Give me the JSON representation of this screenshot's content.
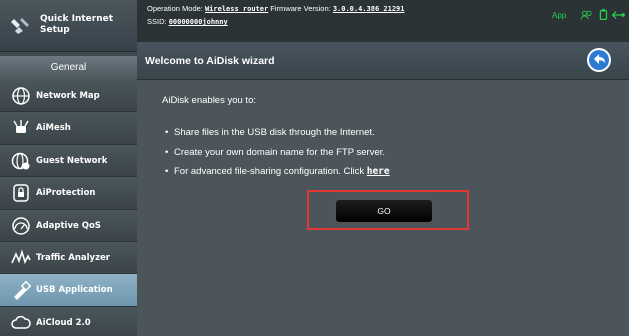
{
  "sidebar": {
    "quick_setup": "Quick Internet Setup",
    "section_header": "General",
    "items": [
      {
        "label": "Network Map"
      },
      {
        "label": "AiMesh"
      },
      {
        "label": "Guest Network"
      },
      {
        "label": "AiProtection"
      },
      {
        "label": "Adaptive QoS"
      },
      {
        "label": "Traffic Analyzer"
      },
      {
        "label": "USB Application",
        "active": true
      },
      {
        "label": "AiCloud 2.0"
      }
    ]
  },
  "header": {
    "op_mode_label": "Operation Mode:",
    "op_mode_value": "Wireless router",
    "fw_label": "Firmware Version:",
    "fw_value": "3.0.0.4.386_21291",
    "ssid_label": "SSID:",
    "ssid_value": "00000000johnny",
    "app_label": "App",
    "status_colors": {
      "app": "#2bd34b"
    }
  },
  "wizard": {
    "title": "Welcome to AiDisk wizard",
    "intro": "AiDisk enables you to:",
    "bullets": [
      "Share files in the USB disk through the Internet.",
      "Create your own domain name for the FTP server.",
      "For advanced file-sharing configuration. Click"
    ],
    "link_text": "here",
    "go_label": "GO",
    "highlight_color": "#e13a36"
  }
}
